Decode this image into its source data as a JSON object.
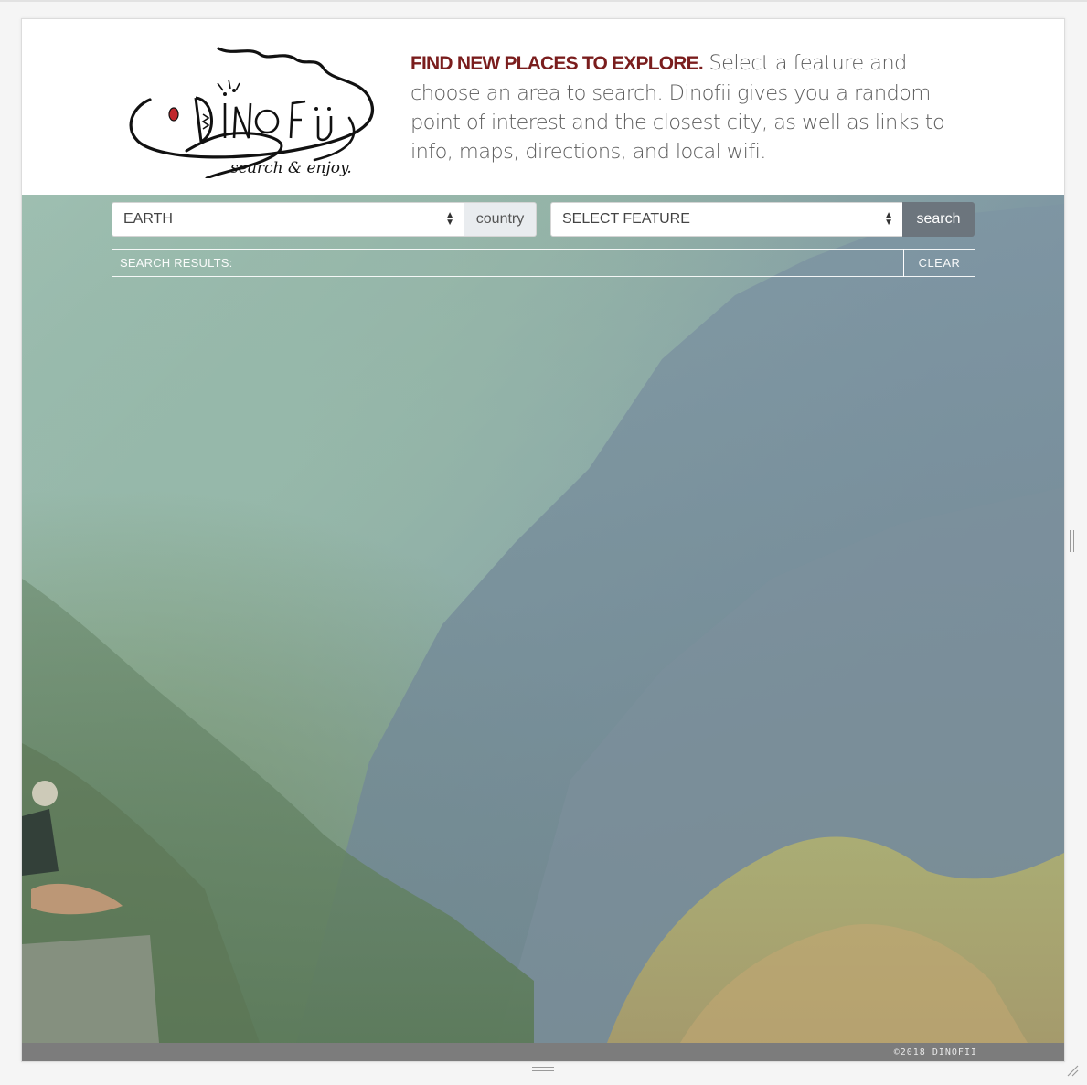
{
  "header": {
    "tagline_lead": "FIND NEW PLACES TO EXPLORE.",
    "tagline_body": " Select a feature and choose an area to search. Dinofii gives you a random point of interest and the closest city, as well as links to info, maps, directions, and local wifi.",
    "logo_word": "Dinofii",
    "logo_sub": "search & enjoy."
  },
  "controls": {
    "area_select_value": "EARTH",
    "area_addon_label": "country",
    "feature_select_value": "SELECT FEATURE",
    "search_button_label": "search",
    "results_label": "SEARCH RESULTS:",
    "clear_button_label": "CLEAR"
  },
  "footer": {
    "copyright": "©2018 DINOFII"
  },
  "colors": {
    "accent": "#7a1d1d",
    "button": "#6c757d",
    "footer": "#7c7c7c"
  }
}
